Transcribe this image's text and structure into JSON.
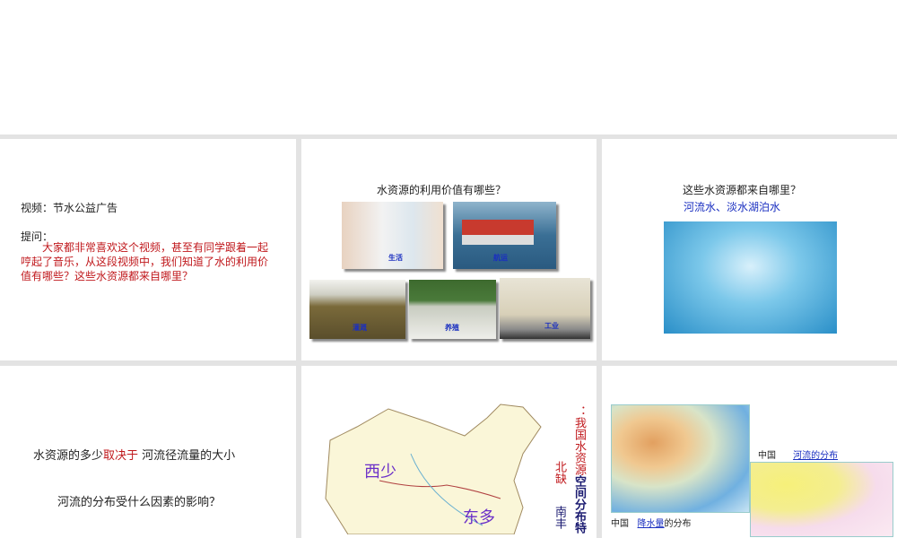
{
  "slide1": {
    "video": "视频：节水公益广告",
    "question_label": "提问：",
    "question": "大家都非常喜欢这个视频，甚至有同学跟着一起哼起了音乐，从这段视频中，我们知道了水的利用价值有哪些？这些水资源都来自哪里？"
  },
  "slide2": {
    "title": "水资源的利用价值有哪些？",
    "labels": [
      "生活",
      "航运",
      "灌溉",
      "养殖",
      "工业"
    ]
  },
  "slide3": {
    "title": "这些水资源都来自哪里？",
    "answer": "河流水、淡水湖泊水"
  },
  "slide4": {
    "line1_a": "水资源的多少",
    "line1_b": "取决于",
    "line1_c": " 河流径流量的大小",
    "line2": "河流的分布受什么因素的影响？"
  },
  "slide5": {
    "west": "西少",
    "east": "东多",
    "title_a": "：我国水资源",
    "title_b": "空间分布特",
    "north": "北缺",
    "south": "南丰"
  },
  "slide6": {
    "cap1_a": "中国",
    "cap1_b": "降水量",
    "cap1_c": "的分布",
    "cap2_a": "中国",
    "cap2_b": "河流的分布"
  }
}
